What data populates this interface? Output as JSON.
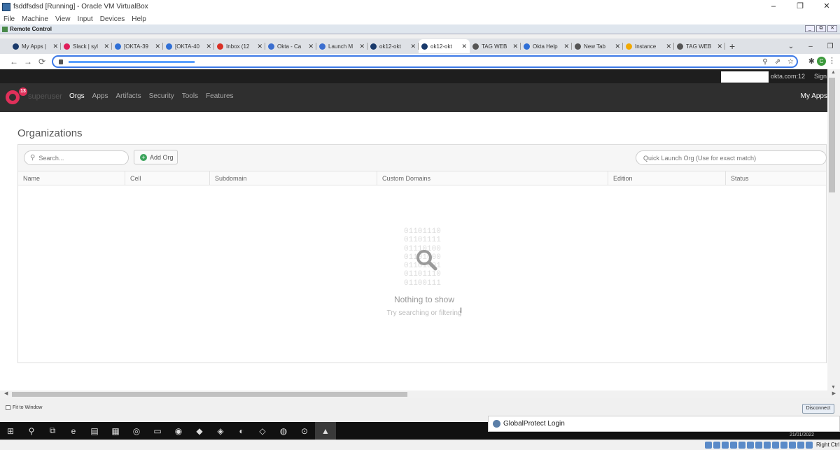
{
  "window": {
    "title": "fsddfsdsd [Running] - Oracle VM VirtualBox",
    "controls": {
      "minimize": "–",
      "maximize": "❐",
      "close": "✕"
    }
  },
  "vbox_menu": [
    "File",
    "Machine",
    "View",
    "Input",
    "Devices",
    "Help"
  ],
  "remote_control": {
    "label": "Remote Control",
    "buttons": [
      "_",
      "⧉",
      "✕"
    ]
  },
  "browser": {
    "tabs": [
      {
        "label": "My Apps |",
        "color": "#1a3a6b"
      },
      {
        "label": "Slack | syl",
        "color": "#e01e5a"
      },
      {
        "label": "[OKTA-39",
        "color": "#2f6fd6"
      },
      {
        "label": "[OKTA-40",
        "color": "#2f6fd6"
      },
      {
        "label": "Inbox (12",
        "color": "#d93025"
      },
      {
        "label": "Okta - Ca",
        "color": "#3b6ecf"
      },
      {
        "label": "Launch M",
        "color": "#3b6ecf"
      },
      {
        "label": "ok12-okt",
        "color": "#1a3a6b"
      },
      {
        "label": "ok12-okt",
        "color": "#1a3a6b",
        "active": true
      },
      {
        "label": "TAG WEB",
        "color": "#555555"
      },
      {
        "label": "Okta Help",
        "color": "#2f6fd6"
      },
      {
        "label": "New Tab",
        "color": "#555555"
      },
      {
        "label": "Instance",
        "color": "#f2a900"
      },
      {
        "label": "TAG WEB",
        "color": "#555555"
      }
    ],
    "close_glyph": "✕",
    "new_tab": "+",
    "tab_menu": [
      "⌄",
      "–",
      "❐"
    ],
    "icons": {
      "back": "←",
      "forward": "→",
      "reload": "⟳",
      "zoom": "⚲",
      "share": "⇗",
      "bookmark": "☆",
      "extensions": "✱",
      "profile": "C",
      "menu": "⋮"
    }
  },
  "okta": {
    "top_domain": "okta.com:12",
    "top_sign": "Sign",
    "badge": "13",
    "brand": "superuser",
    "nav": [
      {
        "label": "Orgs",
        "active": true
      },
      {
        "label": "Apps"
      },
      {
        "label": "Artifacts"
      },
      {
        "label": "Security"
      },
      {
        "label": "Tools"
      },
      {
        "label": "Features"
      }
    ],
    "my_apps": "My Apps",
    "page_title": "Organizations",
    "search_placeholder": "Search...",
    "add_org": "Add Org",
    "quick_launch_placeholder": "Quick Launch Org (Use for exact match)",
    "columns": [
      "Name",
      "Cell",
      "Subdomain",
      "Custom Domains",
      "Edition",
      "Status"
    ],
    "binary_text": "01101110\n01101111\n01110100\n01101000\n01101001\n01101110\n01100111",
    "empty_title": "Nothing to show",
    "empty_hint": "Try searching or filtering"
  },
  "vbox_status": {
    "fit_to_window": "Fit to Window",
    "disconnect": "Disconnect"
  },
  "taskbar": {
    "items": [
      "⊞",
      "⚲",
      "⧉",
      "e",
      "▤",
      "▦",
      "◎",
      "▭",
      "◉",
      "◆",
      "◈",
      "◐",
      "◇",
      "◍",
      "⊙",
      "▲"
    ],
    "globalprotect": "GlobalProtect Login",
    "date": "21/01/2022",
    "right_ctrl": "Right Ctrl"
  }
}
